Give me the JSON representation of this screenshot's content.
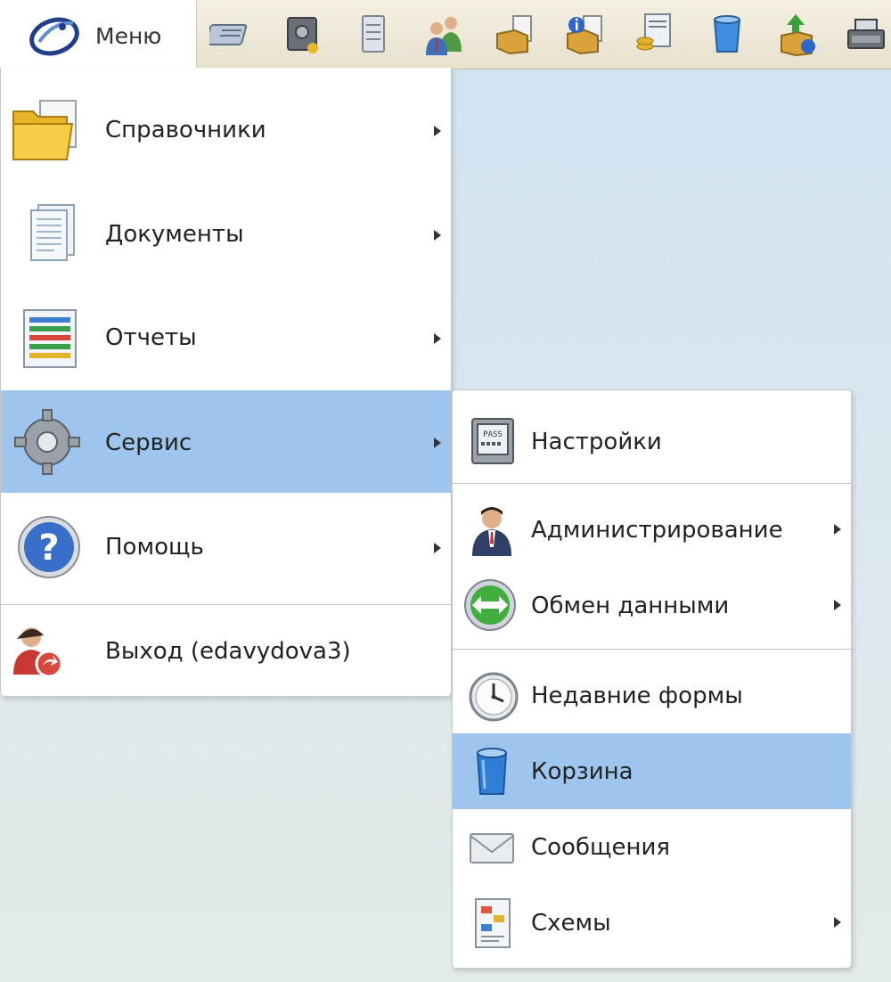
{
  "toolbar": {
    "menu_label": "Меню",
    "icons": [
      "address-book-icon",
      "safe-icon",
      "calculator-icon",
      "users-icon",
      "package-document-icon",
      "package-info-icon",
      "coins-document-icon",
      "money-invoice-icon",
      "recycle-bin-icon",
      "box-upload-icon",
      "cash-register-icon"
    ]
  },
  "main_menu": {
    "items": [
      {
        "label": "Справочники",
        "icon": "folder-icon",
        "submenu": true
      },
      {
        "label": "Документы",
        "icon": "documents-icon",
        "submenu": true
      },
      {
        "label": "Отчеты",
        "icon": "report-icon",
        "submenu": true
      },
      {
        "label": "Сервис",
        "icon": "gear-icon",
        "submenu": true,
        "selected": true
      },
      {
        "label": "Помощь",
        "icon": "help-icon",
        "submenu": true
      },
      {
        "label": "Выход (edavydova3)",
        "icon": "logout-icon",
        "submenu": false
      }
    ]
  },
  "sub_menu": {
    "items": [
      {
        "label": "Настройки",
        "icon": "settings-panel-icon",
        "submenu": false
      },
      {
        "label": "Администрирование",
        "icon": "admin-user-icon",
        "submenu": true
      },
      {
        "label": "Обмен данными",
        "icon": "data-exchange-icon",
        "submenu": true
      },
      {
        "label": "Недавние формы",
        "icon": "clock-icon",
        "submenu": false
      },
      {
        "label": "Корзина",
        "icon": "trash-icon",
        "submenu": false,
        "selected": true
      },
      {
        "label": "Сообщения",
        "icon": "envelope-icon",
        "submenu": false
      },
      {
        "label": "Схемы",
        "icon": "schema-icon",
        "submenu": true
      }
    ]
  },
  "colors": {
    "selection": "#9ec5ee",
    "toolbar": "#ebe5d2",
    "background": "#d6e7f1"
  }
}
